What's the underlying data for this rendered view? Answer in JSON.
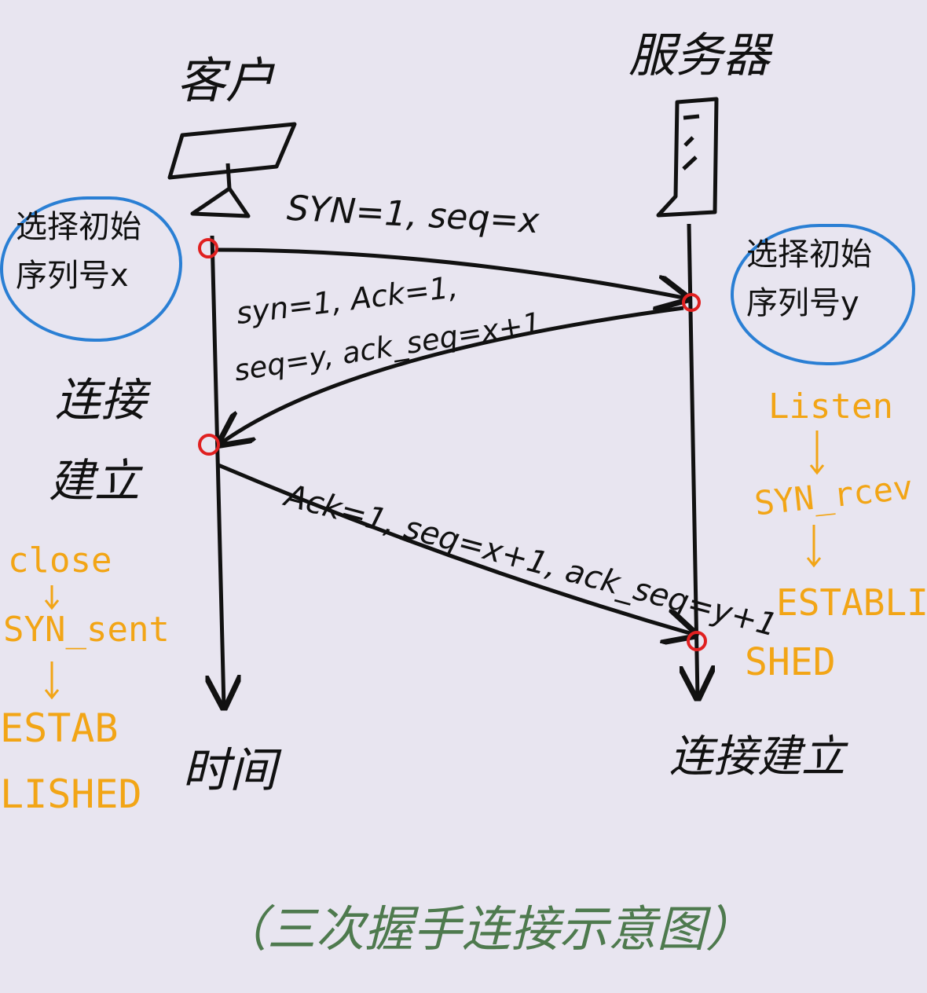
{
  "client": {
    "title": "客户"
  },
  "server": {
    "title": "服务器"
  },
  "client_note": {
    "line1": "选择初始",
    "line2": "序列号x"
  },
  "server_note": {
    "line1": "选择初始",
    "line2": "序列号y"
  },
  "messages": {
    "syn": "SYN=1, seq=x",
    "synack_line1": "syn=1, Ack=1,",
    "synack_line2": "seq=y, ack_seq=x+1",
    "ack_line1": "Ack=1, seq=x+1, ack_seq=y+1"
  },
  "client_established": {
    "line1": "连接",
    "line2": "建立"
  },
  "server_established": "连接建立",
  "time_label": "时间",
  "client_states": [
    "close",
    "SYN_sent",
    "ESTAB",
    "LISHED"
  ],
  "server_states": [
    "Listen",
    "SYN_rcev",
    "ESTABLI",
    "SHED"
  ],
  "caption": "（三次握手连接示意图）",
  "colors": {
    "background": "#e8e5f0",
    "ink": "#111111",
    "state": "#f2a516",
    "note_border": "#2a7fd4",
    "marker": "#e02020",
    "caption": "#4e7a4e"
  }
}
